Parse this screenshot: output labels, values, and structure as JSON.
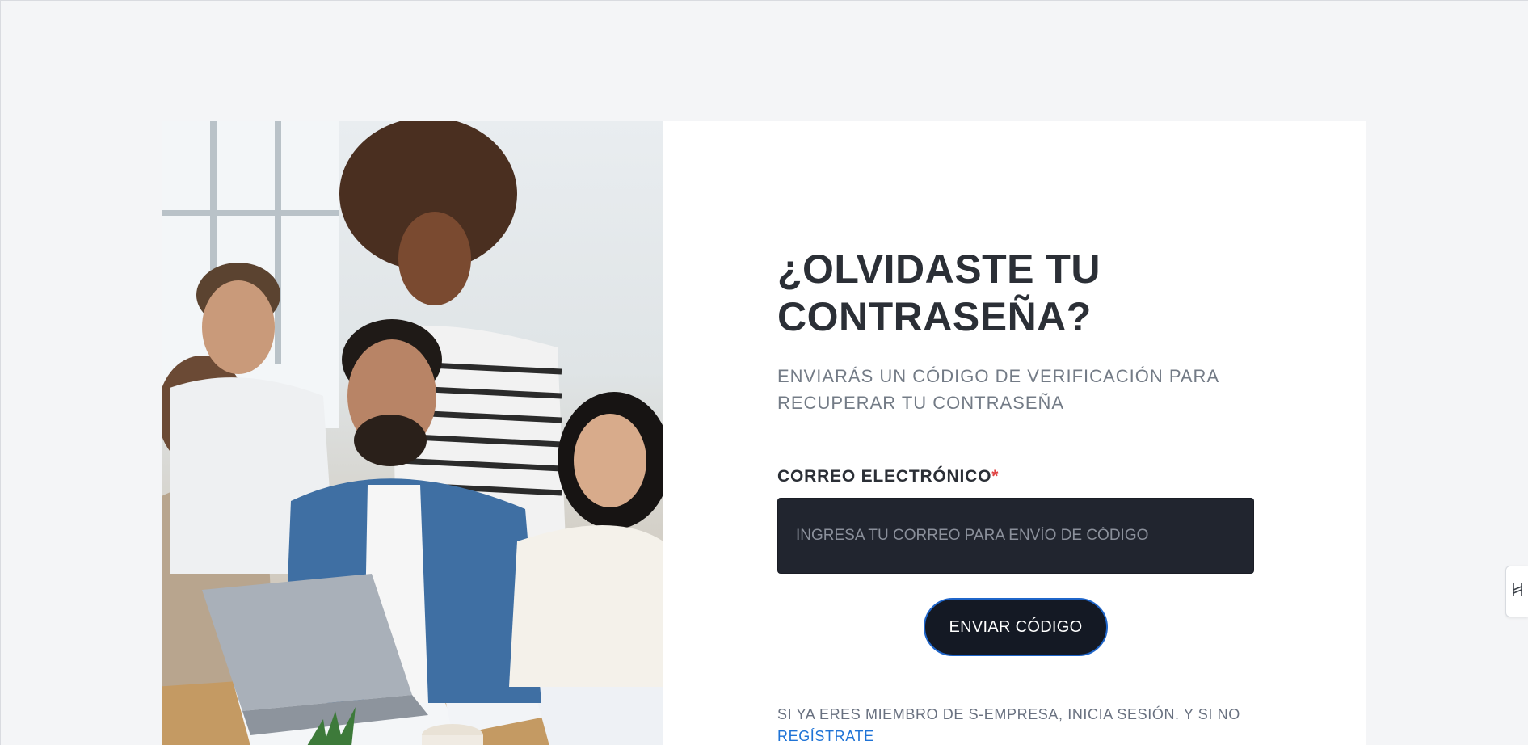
{
  "form": {
    "title": "¿OLVIDASTE TU CONTRASEÑA?",
    "subtitle": "ENVIARÁS UN CÓDIGO DE VERIFICACIÓN PARA RECUPERAR TU CONTRASEÑA",
    "email_label": "CORREO ELECTRÓNICO",
    "required_mark": "*",
    "email_value": "",
    "email_placeholder": "INGRESA TU CORREO PARA ENVÍO DE CÓDIGO",
    "submit_label": "ENVIAR CÓDIGO"
  },
  "footer": {
    "text": "SI YA ERES MIEMBRO DE S-EMPRESA, INICIA SESIÓN. Y SI NO",
    "register_link": "REGÍSTRATE"
  },
  "icons": {
    "side_tab": "collapse-arrows-icon"
  },
  "colors": {
    "title": "#2b2f36",
    "input_bg": "#21252f",
    "button_bg": "#141924",
    "button_border": "#1f65c9",
    "link": "#1f73d6",
    "required": "#e04444"
  }
}
